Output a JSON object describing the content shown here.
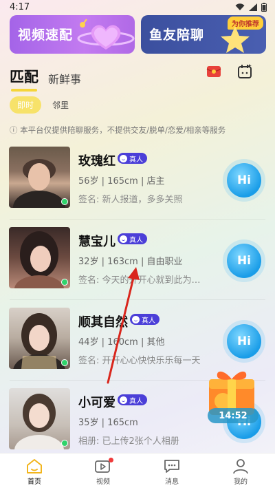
{
  "status": {
    "time": "4:17"
  },
  "banners": {
    "left_text": "视频速配",
    "right_text": "鱼友陪聊",
    "right_tag": "为你推荐"
  },
  "tabs": [
    {
      "label": "匹配",
      "active": true
    },
    {
      "label": "新鲜事",
      "active": false
    }
  ],
  "subtabs": [
    {
      "label": "即时",
      "active": true
    },
    {
      "label": "邻里",
      "active": false
    }
  ],
  "notice": "ⓘ 本平台仅提供陪聊服务，不提供交友/脱单/恋爱/相亲等服务",
  "badge_label": "真人",
  "hi_label": "Hi",
  "users": [
    {
      "name": "玫瑰红",
      "meta": "56岁 | 165cm | 店主",
      "sig": "签名: 新人报道，多多关照"
    },
    {
      "name": "慧宝儿",
      "meta": "32岁 | 163cm | 自由职业",
      "sig": "签名: 今天的开开心就到此为…"
    },
    {
      "name": "顺其自然",
      "meta": "44岁 | 160cm | 其他",
      "sig": "签名: 开开心心快快乐乐每一天"
    },
    {
      "name": "小可爱",
      "meta": "35岁 | 165cm",
      "sig": "相册: 已上传2张个人相册"
    }
  ],
  "gift_timer": "14:52",
  "nav": [
    {
      "label": "首页",
      "icon": "home-icon",
      "active": true
    },
    {
      "label": "视频",
      "icon": "video-icon",
      "active": false,
      "badge": true
    },
    {
      "label": "消息",
      "icon": "message-icon",
      "active": false
    },
    {
      "label": "我的",
      "icon": "profile-icon",
      "active": false
    }
  ],
  "colors": {
    "accent": "#f5d53a",
    "badge": "#4b3fd8",
    "hi": "#1a9de8",
    "online": "#2fd36b"
  }
}
